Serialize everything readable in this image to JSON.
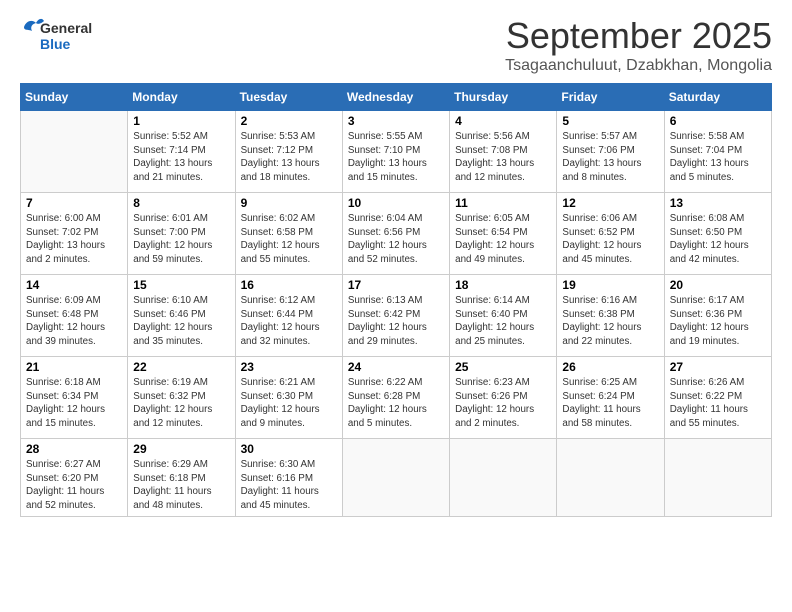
{
  "logo": {
    "general": "General",
    "blue": "Blue"
  },
  "header": {
    "month": "September 2025",
    "subtitle": "Tsagaanchuluut, Dzabkhan, Mongolia"
  },
  "weekdays": [
    "Sunday",
    "Monday",
    "Tuesday",
    "Wednesday",
    "Thursday",
    "Friday",
    "Saturday"
  ],
  "weeks": [
    [
      {
        "day": null
      },
      {
        "day": 1,
        "sunrise": "5:52 AM",
        "sunset": "7:14 PM",
        "daylight": "13 hours and 21 minutes."
      },
      {
        "day": 2,
        "sunrise": "5:53 AM",
        "sunset": "7:12 PM",
        "daylight": "13 hours and 18 minutes."
      },
      {
        "day": 3,
        "sunrise": "5:55 AM",
        "sunset": "7:10 PM",
        "daylight": "13 hours and 15 minutes."
      },
      {
        "day": 4,
        "sunrise": "5:56 AM",
        "sunset": "7:08 PM",
        "daylight": "13 hours and 12 minutes."
      },
      {
        "day": 5,
        "sunrise": "5:57 AM",
        "sunset": "7:06 PM",
        "daylight": "13 hours and 8 minutes."
      },
      {
        "day": 6,
        "sunrise": "5:58 AM",
        "sunset": "7:04 PM",
        "daylight": "13 hours and 5 minutes."
      }
    ],
    [
      {
        "day": 7,
        "sunrise": "6:00 AM",
        "sunset": "7:02 PM",
        "daylight": "13 hours and 2 minutes."
      },
      {
        "day": 8,
        "sunrise": "6:01 AM",
        "sunset": "7:00 PM",
        "daylight": "12 hours and 59 minutes."
      },
      {
        "day": 9,
        "sunrise": "6:02 AM",
        "sunset": "6:58 PM",
        "daylight": "12 hours and 55 minutes."
      },
      {
        "day": 10,
        "sunrise": "6:04 AM",
        "sunset": "6:56 PM",
        "daylight": "12 hours and 52 minutes."
      },
      {
        "day": 11,
        "sunrise": "6:05 AM",
        "sunset": "6:54 PM",
        "daylight": "12 hours and 49 minutes."
      },
      {
        "day": 12,
        "sunrise": "6:06 AM",
        "sunset": "6:52 PM",
        "daylight": "12 hours and 45 minutes."
      },
      {
        "day": 13,
        "sunrise": "6:08 AM",
        "sunset": "6:50 PM",
        "daylight": "12 hours and 42 minutes."
      }
    ],
    [
      {
        "day": 14,
        "sunrise": "6:09 AM",
        "sunset": "6:48 PM",
        "daylight": "12 hours and 39 minutes."
      },
      {
        "day": 15,
        "sunrise": "6:10 AM",
        "sunset": "6:46 PM",
        "daylight": "12 hours and 35 minutes."
      },
      {
        "day": 16,
        "sunrise": "6:12 AM",
        "sunset": "6:44 PM",
        "daylight": "12 hours and 32 minutes."
      },
      {
        "day": 17,
        "sunrise": "6:13 AM",
        "sunset": "6:42 PM",
        "daylight": "12 hours and 29 minutes."
      },
      {
        "day": 18,
        "sunrise": "6:14 AM",
        "sunset": "6:40 PM",
        "daylight": "12 hours and 25 minutes."
      },
      {
        "day": 19,
        "sunrise": "6:16 AM",
        "sunset": "6:38 PM",
        "daylight": "12 hours and 22 minutes."
      },
      {
        "day": 20,
        "sunrise": "6:17 AM",
        "sunset": "6:36 PM",
        "daylight": "12 hours and 19 minutes."
      }
    ],
    [
      {
        "day": 21,
        "sunrise": "6:18 AM",
        "sunset": "6:34 PM",
        "daylight": "12 hours and 15 minutes."
      },
      {
        "day": 22,
        "sunrise": "6:19 AM",
        "sunset": "6:32 PM",
        "daylight": "12 hours and 12 minutes."
      },
      {
        "day": 23,
        "sunrise": "6:21 AM",
        "sunset": "6:30 PM",
        "daylight": "12 hours and 9 minutes."
      },
      {
        "day": 24,
        "sunrise": "6:22 AM",
        "sunset": "6:28 PM",
        "daylight": "12 hours and 5 minutes."
      },
      {
        "day": 25,
        "sunrise": "6:23 AM",
        "sunset": "6:26 PM",
        "daylight": "12 hours and 2 minutes."
      },
      {
        "day": 26,
        "sunrise": "6:25 AM",
        "sunset": "6:24 PM",
        "daylight": "11 hours and 58 minutes."
      },
      {
        "day": 27,
        "sunrise": "6:26 AM",
        "sunset": "6:22 PM",
        "daylight": "11 hours and 55 minutes."
      }
    ],
    [
      {
        "day": 28,
        "sunrise": "6:27 AM",
        "sunset": "6:20 PM",
        "daylight": "11 hours and 52 minutes."
      },
      {
        "day": 29,
        "sunrise": "6:29 AM",
        "sunset": "6:18 PM",
        "daylight": "11 hours and 48 minutes."
      },
      {
        "day": 30,
        "sunrise": "6:30 AM",
        "sunset": "6:16 PM",
        "daylight": "11 hours and 45 minutes."
      },
      {
        "day": null
      },
      {
        "day": null
      },
      {
        "day": null
      },
      {
        "day": null
      }
    ]
  ]
}
